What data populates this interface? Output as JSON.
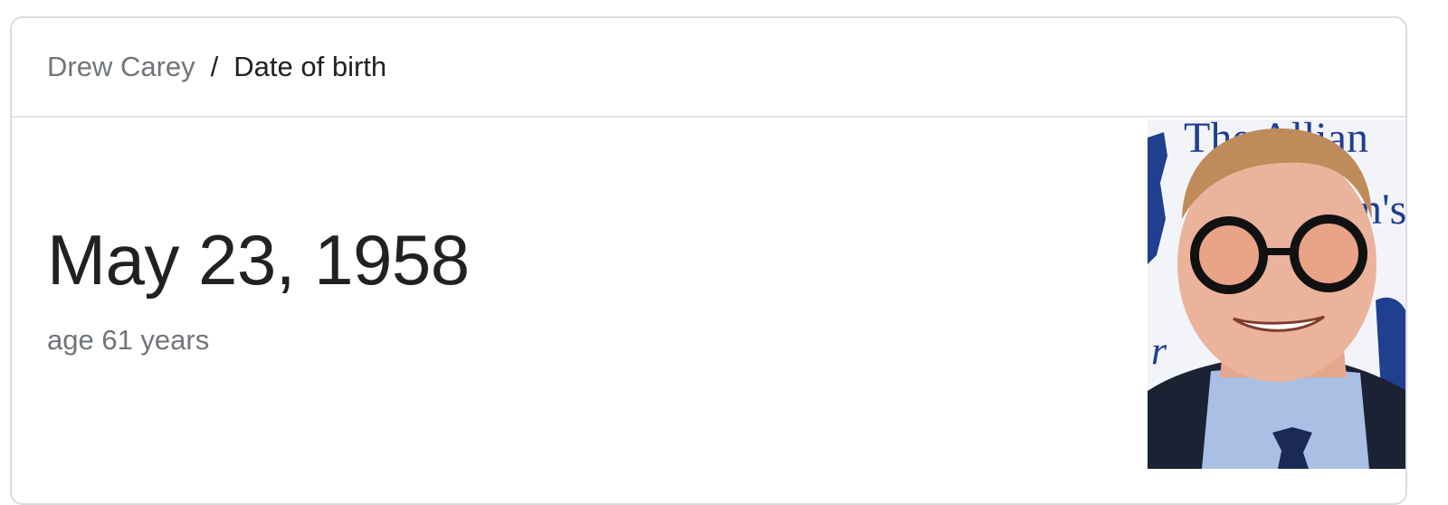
{
  "breadcrumb": {
    "parent": "Drew Carey",
    "separator": "/",
    "current": "Date of birth"
  },
  "answer": {
    "value": "May 23, 1958",
    "subtitle": "age 61 years"
  },
  "photo": {
    "backdrop_text_top": "The Allian",
    "backdrop_text_mid": "n's",
    "backdrop_text_low": "r"
  },
  "colors": {
    "secondary_text": "#70757a",
    "primary_text": "#202124",
    "border": "#dadce0"
  }
}
